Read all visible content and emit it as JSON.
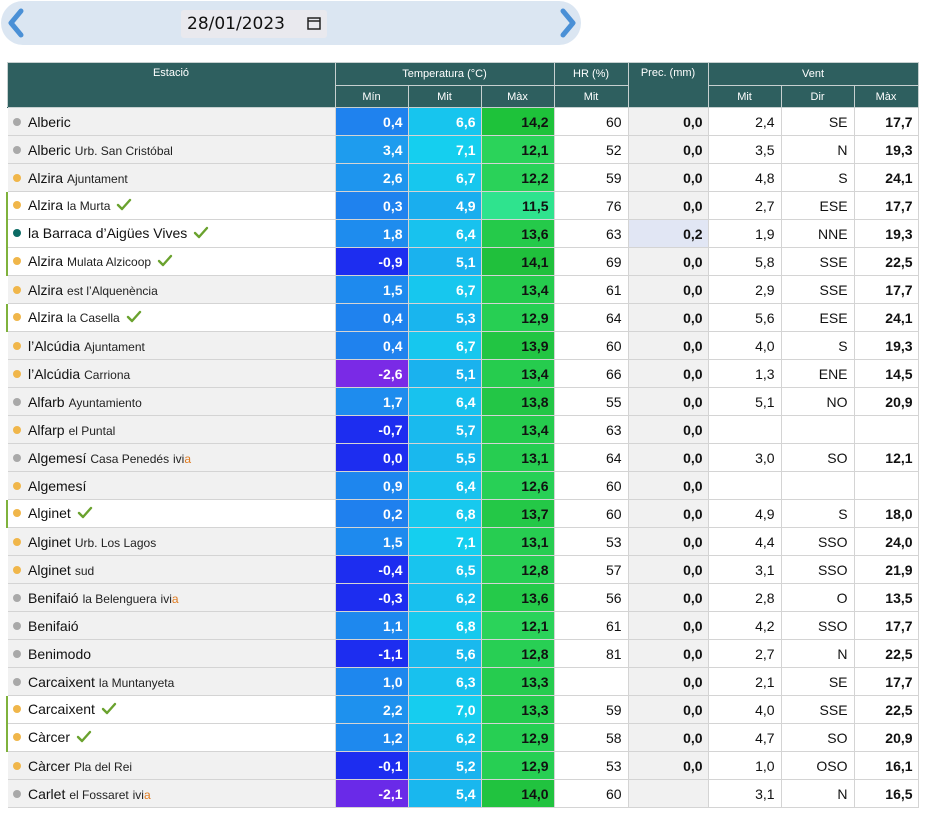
{
  "date": {
    "value": "28/01/2023"
  },
  "colors": {
    "header_bg": "#2e5f5f",
    "accent_green": "#7fb23c",
    "arrow_blue": "#4a90d6",
    "prec_highlight": "#e1e6f4"
  },
  "header": {
    "station": "Estació",
    "temp": "Temperatura (°C)",
    "hr": "HR (%)",
    "prec": "Prec. (mm)",
    "wind": "Vent",
    "min": "Mín",
    "mit": "Mit",
    "max": "Màx",
    "hr_mit": "Mit",
    "w_mit": "Mit",
    "w_dir": "Dir",
    "w_max": "Màx"
  },
  "rows": [
    {
      "name": "Alberic",
      "loc": "",
      "ivi": false,
      "check": false,
      "dot": "gray",
      "bg": "#f1f1f1",
      "tmin": "0,4",
      "tmin_c": "#1f82ee",
      "tmit": "6,6",
      "tmit_c": "#17c5ee",
      "tmax": "14,2",
      "tmax_c": "#1ec23a",
      "hr": "60",
      "prec": "0,0",
      "wmit": "2,4",
      "wdir": "SE",
      "wmax": "17,7"
    },
    {
      "name": "Alberic",
      "loc": "Urb. San Cristóbal",
      "ivi": false,
      "check": false,
      "dot": "gray",
      "bg": "#f1f1f1",
      "tmin": "3,4",
      "tmin_c": "#1e9cee",
      "tmit": "7,1",
      "tmit_c": "#15cfef",
      "tmax": "12,1",
      "tmax_c": "#2bd35a",
      "hr": "52",
      "prec": "0,0",
      "wmit": "3,5",
      "wdir": "N",
      "wmax": "19,3"
    },
    {
      "name": "Alzira",
      "loc": "Ajuntament",
      "ivi": false,
      "check": false,
      "dot": "orange",
      "bg": "#f1f1f1",
      "tmin": "2,6",
      "tmin_c": "#1e95ee",
      "tmit": "6,7",
      "tmit_c": "#17c7ee",
      "tmax": "12,2",
      "tmax_c": "#2ad259",
      "hr": "59",
      "prec": "0,0",
      "wmit": "4,8",
      "wdir": "S",
      "wmax": "24,1"
    },
    {
      "name": "Alzira",
      "loc": "la Murta",
      "ivi": false,
      "check": true,
      "dot": "orange",
      "bg": "#ffffff",
      "tmin": "0,3",
      "tmin_c": "#1f82ee",
      "tmit": "4,9",
      "tmit_c": "#1aaeee",
      "tmax": "11,5",
      "tmax_c": "#2fe38e",
      "hr": "76",
      "prec": "0,0",
      "wmit": "2,7",
      "wdir": "ESE",
      "wmax": "17,7"
    },
    {
      "name": "la Barraca d’Aigües Vives",
      "loc": "",
      "ivi": false,
      "check": true,
      "dot": "teal",
      "bg": "#ffffff",
      "tmin": "1,8",
      "tmin_c": "#1e8cee",
      "tmit": "6,4",
      "tmit_c": "#18c2ee",
      "tmax": "13,6",
      "tmax_c": "#25ca4a",
      "hr": "63",
      "prec": "0,2",
      "prec_bg": "#e1e6f4",
      "wmit": "1,9",
      "wdir": "NNE",
      "wmax": "19,3"
    },
    {
      "name": "Alzira",
      "loc": "Mulata Alzicoop",
      "ivi": false,
      "check": true,
      "dot": "orange",
      "bg": "#ffffff",
      "tmin": "-0,9",
      "tmin_c": "#1d2df0",
      "tmit": "5,1",
      "tmit_c": "#1ab2ee",
      "tmax": "14,1",
      "tmax_c": "#20c03c",
      "hr": "69",
      "prec": "0,0",
      "wmit": "5,8",
      "wdir": "SSE",
      "wmax": "22,5"
    },
    {
      "name": "Alzira",
      "loc": "est l’Alquenència",
      "ivi": false,
      "check": false,
      "dot": "orange",
      "bg": "#f1f1f1",
      "tmin": "1,5",
      "tmin_c": "#1e8aee",
      "tmit": "6,7",
      "tmit_c": "#17c7ee",
      "tmax": "13,4",
      "tmax_c": "#26cc4e",
      "hr": "61",
      "prec": "0,0",
      "wmit": "2,9",
      "wdir": "SSE",
      "wmax": "17,7"
    },
    {
      "name": "Alzira",
      "loc": "la Casella",
      "ivi": false,
      "check": true,
      "dot": "orange",
      "bg": "#ffffff",
      "tmin": "0,4",
      "tmin_c": "#1f82ee",
      "tmit": "5,3",
      "tmit_c": "#19b5ee",
      "tmax": "12,9",
      "tmax_c": "#27cf53",
      "hr": "64",
      "prec": "0,0",
      "wmit": "5,6",
      "wdir": "ESE",
      "wmax": "24,1"
    },
    {
      "name": "l’Alcúdia",
      "loc": "Ajuntament",
      "ivi": false,
      "check": false,
      "dot": "orange",
      "bg": "#f1f1f1",
      "tmin": "0,4",
      "tmin_c": "#1f82ee",
      "tmit": "6,7",
      "tmit_c": "#17c7ee",
      "tmax": "13,9",
      "tmax_c": "#22c543",
      "hr": "60",
      "prec": "0,0",
      "wmit": "4,0",
      "wdir": "S",
      "wmax": "19,3"
    },
    {
      "name": "l’Alcúdia",
      "loc": "Carriona",
      "ivi": false,
      "check": false,
      "dot": "orange",
      "bg": "#f1f1f1",
      "tmin": "-2,6",
      "tmin_c": "#7a2ae6",
      "tmit": "5,1",
      "tmit_c": "#1ab2ee",
      "tmax": "13,4",
      "tmax_c": "#26cc4e",
      "hr": "66",
      "prec": "0,0",
      "wmit": "1,3",
      "wdir": "ENE",
      "wmax": "14,5"
    },
    {
      "name": "Alfarb",
      "loc": "Ayuntamiento",
      "ivi": false,
      "check": false,
      "dot": "gray",
      "bg": "#f1f1f1",
      "tmin": "1,7",
      "tmin_c": "#1e8cee",
      "tmit": "6,4",
      "tmit_c": "#18c2ee",
      "tmax": "13,8",
      "tmax_c": "#23c646",
      "hr": "55",
      "prec": "0,0",
      "wmit": "5,1",
      "wdir": "NO",
      "wmax": "20,9"
    },
    {
      "name": "Alfarp",
      "loc": "el Puntal",
      "ivi": false,
      "check": false,
      "dot": "orange",
      "bg": "#f1f1f1",
      "tmin": "-0,7",
      "tmin_c": "#1d2df0",
      "tmit": "5,7",
      "tmit_c": "#19baee",
      "tmax": "13,4",
      "tmax_c": "#26cc4e",
      "hr": "63",
      "prec": "0,0",
      "wmit": "",
      "wdir": "",
      "wmax": ""
    },
    {
      "name": "Algemesí",
      "loc": "Casa Penedés",
      "ivi": true,
      "check": false,
      "dot": "gray",
      "bg": "#f1f1f1",
      "tmin": "0,0",
      "tmin_c": "#1d2df0",
      "tmit": "5,5",
      "tmit_c": "#19b8ee",
      "tmax": "13,1",
      "tmax_c": "#27cd51",
      "hr": "64",
      "prec": "0,0",
      "wmit": "3,0",
      "wdir": "SO",
      "wmax": "12,1"
    },
    {
      "name": "Algemesí",
      "loc": "",
      "ivi": false,
      "check": false,
      "dot": "orange",
      "bg": "#f1f1f1",
      "tmin": "0,9",
      "tmin_c": "#1e86ee",
      "tmit": "6,4",
      "tmit_c": "#18c2ee",
      "tmax": "12,6",
      "tmax_c": "#28d056",
      "hr": "60",
      "prec": "0,0",
      "wmit": "",
      "wdir": "",
      "wmax": ""
    },
    {
      "name": "Alginet",
      "loc": "",
      "ivi": false,
      "check": true,
      "dot": "orange",
      "bg": "#ffffff",
      "tmin": "0,2",
      "tmin_c": "#1f80ee",
      "tmit": "6,8",
      "tmit_c": "#17c9ee",
      "tmax": "13,7",
      "tmax_c": "#24c847",
      "hr": "60",
      "prec": "0,0",
      "wmit": "4,9",
      "wdir": "S",
      "wmax": "18,0"
    },
    {
      "name": "Alginet",
      "loc": "Urb. Los Lagos",
      "ivi": false,
      "check": false,
      "dot": "orange",
      "bg": "#f1f1f1",
      "tmin": "1,5",
      "tmin_c": "#1e8aee",
      "tmit": "7,1",
      "tmit_c": "#15cfef",
      "tmax": "13,1",
      "tmax_c": "#27cd51",
      "hr": "53",
      "prec": "0,0",
      "wmit": "4,4",
      "wdir": "SSO",
      "wmax": "24,0"
    },
    {
      "name": "Alginet",
      "loc": "sud",
      "ivi": false,
      "check": false,
      "dot": "orange",
      "bg": "#f1f1f1",
      "tmin": "-0,4",
      "tmin_c": "#1d2df0",
      "tmit": "6,5",
      "tmit_c": "#18c4ee",
      "tmax": "12,8",
      "tmax_c": "#28cf54",
      "hr": "57",
      "prec": "0,0",
      "wmit": "3,1",
      "wdir": "SSO",
      "wmax": "21,9"
    },
    {
      "name": "Benifaió",
      "loc": "la Belenguera",
      "ivi": true,
      "check": false,
      "dot": "gray",
      "bg": "#f1f1f1",
      "tmin": "-0,3",
      "tmin_c": "#1d2df0",
      "tmit": "6,2",
      "tmit_c": "#18c0ee",
      "tmax": "13,6",
      "tmax_c": "#25ca4a",
      "hr": "56",
      "prec": "0,0",
      "wmit": "2,8",
      "wdir": "O",
      "wmax": "13,5"
    },
    {
      "name": "Benifaió",
      "loc": "",
      "ivi": false,
      "check": false,
      "dot": "gray",
      "bg": "#f1f1f1",
      "tmin": "1,1",
      "tmin_c": "#1e88ee",
      "tmit": "6,8",
      "tmit_c": "#17c9ee",
      "tmax": "12,1",
      "tmax_c": "#2bd35a",
      "hr": "61",
      "prec": "0,0",
      "wmit": "4,2",
      "wdir": "SSO",
      "wmax": "17,7"
    },
    {
      "name": "Benimodo",
      "loc": "",
      "ivi": false,
      "check": false,
      "dot": "gray",
      "bg": "#f1f1f1",
      "tmin": "-1,1",
      "tmin_c": "#1d2df0",
      "tmit": "5,6",
      "tmit_c": "#19b9ee",
      "tmax": "12,8",
      "tmax_c": "#28cf54",
      "hr": "81",
      "prec": "0,0",
      "wmit": "2,7",
      "wdir": "N",
      "wmax": "22,5"
    },
    {
      "name": "Carcaixent",
      "loc": "la Muntanyeta",
      "ivi": false,
      "check": false,
      "dot": "gray",
      "bg": "#f1f1f1",
      "tmin": "1,0",
      "tmin_c": "#1e87ee",
      "tmit": "6,3",
      "tmit_c": "#18c1ee",
      "tmax": "13,3",
      "tmax_c": "#26cc4f",
      "hr": "",
      "prec": "0,0",
      "wmit": "2,1",
      "wdir": "SE",
      "wmax": "17,7"
    },
    {
      "name": "Carcaixent",
      "loc": "",
      "ivi": false,
      "check": true,
      "dot": "orange",
      "bg": "#ffffff",
      "tmin": "2,2",
      "tmin_c": "#1e91ee",
      "tmit": "7,0",
      "tmit_c": "#16cdef",
      "tmax": "13,3",
      "tmax_c": "#26cc4f",
      "hr": "59",
      "prec": "0,0",
      "wmit": "4,0",
      "wdir": "SSE",
      "wmax": "22,5"
    },
    {
      "name": "Càrcer",
      "loc": "",
      "ivi": false,
      "check": true,
      "dot": "orange",
      "bg": "#ffffff",
      "tmin": "1,2",
      "tmin_c": "#1e89ee",
      "tmit": "6,2",
      "tmit_c": "#18c0ee",
      "tmax": "12,9",
      "tmax_c": "#27cf53",
      "hr": "58",
      "prec": "0,0",
      "wmit": "4,7",
      "wdir": "SO",
      "wmax": "20,9"
    },
    {
      "name": "Càrcer",
      "loc": "Pla del Rei",
      "ivi": false,
      "check": false,
      "dot": "orange",
      "bg": "#f1f1f1",
      "tmin": "-0,1",
      "tmin_c": "#1d2df0",
      "tmit": "5,2",
      "tmit_c": "#1ab3ee",
      "tmax": "12,9",
      "tmax_c": "#27cf53",
      "hr": "53",
      "prec": "0,0",
      "wmit": "1,0",
      "wdir": "OSO",
      "wmax": "16,1"
    },
    {
      "name": "Carlet",
      "loc": "el Fossaret",
      "ivi": true,
      "check": false,
      "dot": "gray",
      "bg": "#f1f1f1",
      "tmin": "-2,1",
      "tmin_c": "#6a2ae8",
      "tmit": "5,4",
      "tmit_c": "#19b7ee",
      "tmax": "14,0",
      "tmax_c": "#21c33f",
      "hr": "60",
      "prec": "",
      "wmit": "3,1",
      "wdir": "N",
      "wmax": "16,5"
    }
  ]
}
